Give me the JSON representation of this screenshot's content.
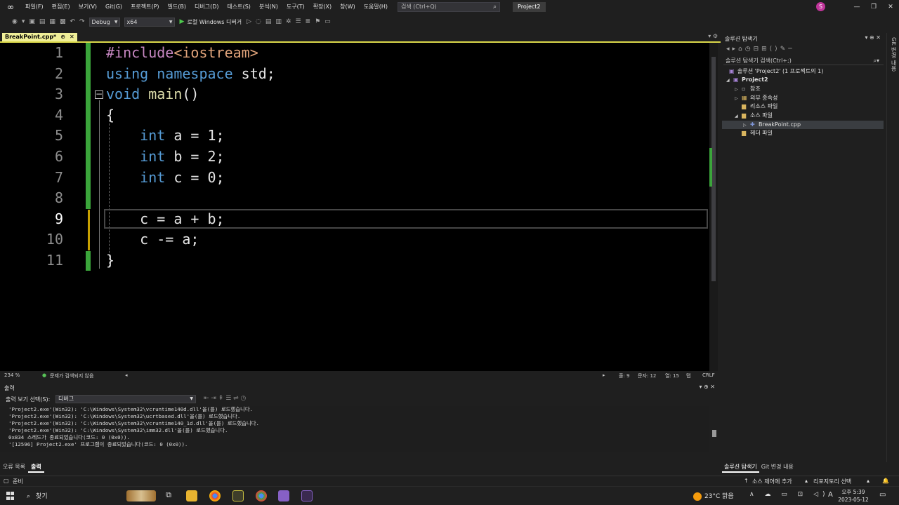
{
  "menubar": {
    "items": [
      "파일(F)",
      "편집(E)",
      "보기(V)",
      "Git(G)",
      "프로젝트(P)",
      "빌드(B)",
      "디버그(D)",
      "테스트(S)",
      "분석(N)",
      "도구(T)",
      "확장(X)",
      "창(W)",
      "도움말(H)"
    ],
    "search_placeholder": "검색 (Ctrl+Q)",
    "project_name": "Project2",
    "avatar_letter": "S",
    "win_min": "—",
    "win_max": "❐",
    "win_close": "✕"
  },
  "toolbar": {
    "config": "Debug",
    "platform": "x64",
    "run_label": "로컬 Windows 디버거"
  },
  "doc_tab": {
    "name": "BreakPoint.cpp*",
    "pin": "⊕",
    "close": "✕"
  },
  "editor": {
    "line_numbers": [
      "1",
      "2",
      "3",
      "4",
      "5",
      "6",
      "7",
      "8",
      "9",
      "10",
      "11"
    ],
    "current_line_index": 8
  },
  "editor_status": {
    "zoom": "234 %",
    "issues": "문제가 검색되지 않음",
    "line": "줄: 9",
    "char": "문자: 12",
    "col": "열: 15",
    "tabs": "탭",
    "eol": "CRLF"
  },
  "output_panel": {
    "title": "출력",
    "source_label": "출력 보기 선택(S):",
    "source_value": "디버그",
    "lines": [
      "'Project2.exe'(Win32): 'C:\\Windows\\System32\\vcruntime140d.dll'을(를) 로드했습니다.",
      "'Project2.exe'(Win32): 'C:\\Windows\\System32\\ucrtbased.dll'을(를) 로드했습니다.",
      "'Project2.exe'(Win32): 'C:\\Windows\\System32\\vcruntime140_1d.dll'을(를) 로드했습니다.",
      "'Project2.exe'(Win32): 'C:\\Windows\\System32\\imm32.dll'을(를) 로드했습니다.",
      "0x834 스레드가 종료되었습니다(코드: 0 (0x0)).",
      "'[12596] Project2.exe' 프로그램이 종료되었습니다(코드: 0 (0x0))."
    ],
    "tabs": [
      "오류 목록",
      "출력"
    ]
  },
  "solution_explorer": {
    "title": "솔루션 탐색기",
    "search_placeholder": "솔루션 탐색기 검색(Ctrl+;)",
    "items": [
      {
        "label": "솔루션 'Project2' (1 프로젝트의 1)"
      },
      {
        "label": "Project2"
      },
      {
        "label": "참조"
      },
      {
        "label": "외부 종속성"
      },
      {
        "label": "리소스 파일"
      },
      {
        "label": "소스 파일"
      },
      {
        "label": "BreakPoint.cpp"
      },
      {
        "label": "헤더 파일"
      }
    ],
    "tabs": [
      "솔루션 탐색기",
      "Git 변경 내용"
    ],
    "side_label": "Git 변경 내용"
  },
  "statusbar": {
    "ready": "준비",
    "source_control": "소스 제어에 추가",
    "repo": "리포지토리 선택"
  },
  "taskbar": {
    "search_label": "찾기",
    "weather": "23°C 맑음",
    "ime": "A",
    "time": "오후 5:39",
    "date": "2023-05-12"
  },
  "colors": {
    "keyword": "#569cd6",
    "function": "#dcdcaa",
    "preprocessor": "#c586c0",
    "change_bar": "#3ba53b",
    "unsaved_bar": "#c7a000",
    "tab_active": "#f0ef98"
  }
}
